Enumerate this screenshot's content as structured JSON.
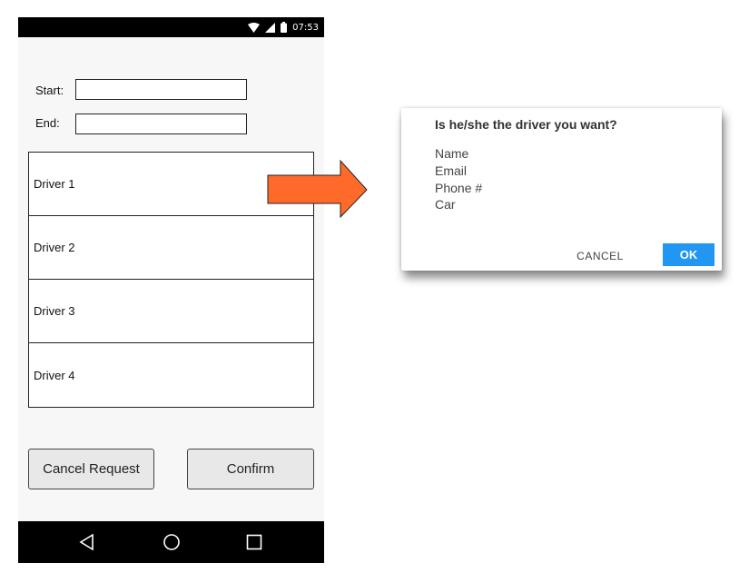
{
  "status_bar": {
    "time": "07:53",
    "icons": [
      "wifi-icon",
      "signal-icon",
      "battery-icon"
    ]
  },
  "form": {
    "start_label": "Start:",
    "start_value": "",
    "end_label": "End:",
    "end_value": ""
  },
  "drivers": [
    {
      "label": "Driver 1"
    },
    {
      "label": "Driver 2"
    },
    {
      "label": "Driver 3"
    },
    {
      "label": "Driver 4"
    }
  ],
  "buttons": {
    "cancel_request": "Cancel Request",
    "confirm": "Confirm"
  },
  "nav": [
    "back-icon",
    "home-icon",
    "recents-icon"
  ],
  "dialog": {
    "title": "Is he/she the driver you want?",
    "details": [
      "Name",
      "Email",
      "Phone #",
      "Car"
    ],
    "cancel": "CANCEL",
    "ok": "OK"
  },
  "colors": {
    "arrow_fill": "#ff6a2b",
    "ok_button": "#2196f3",
    "phone_bg": "#f7f7f7"
  }
}
